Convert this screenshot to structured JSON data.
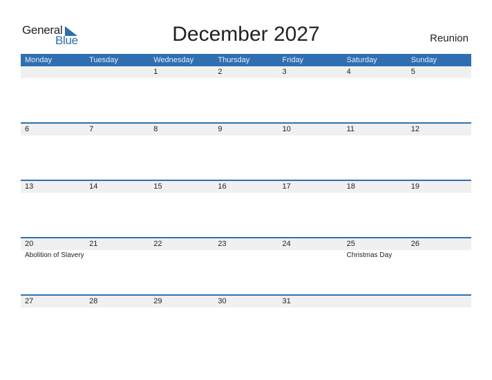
{
  "logo": {
    "word1": "General",
    "word2": "Blue"
  },
  "title": "December 2027",
  "region": "Reunion",
  "colors": {
    "header_bg": "#2e6fb2",
    "accent": "#2a6db5",
    "day_row_bg": "#f0f0f0"
  },
  "weekdays": [
    "Monday",
    "Tuesday",
    "Wednesday",
    "Thursday",
    "Friday",
    "Saturday",
    "Sunday"
  ],
  "weeks": [
    {
      "days": [
        "",
        "",
        "1",
        "2",
        "3",
        "4",
        "5"
      ],
      "holidays": [
        "",
        "",
        "",
        "",
        "",
        "",
        ""
      ]
    },
    {
      "days": [
        "6",
        "7",
        "8",
        "9",
        "10",
        "11",
        "12"
      ],
      "holidays": [
        "",
        "",
        "",
        "",
        "",
        "",
        ""
      ]
    },
    {
      "days": [
        "13",
        "14",
        "15",
        "16",
        "17",
        "18",
        "19"
      ],
      "holidays": [
        "",
        "",
        "",
        "",
        "",
        "",
        ""
      ]
    },
    {
      "days": [
        "20",
        "21",
        "22",
        "23",
        "24",
        "25",
        "26"
      ],
      "holidays": [
        "Abolition of Slavery",
        "",
        "",
        "",
        "",
        "Christmas Day",
        ""
      ]
    },
    {
      "days": [
        "27",
        "28",
        "29",
        "30",
        "31",
        "",
        ""
      ],
      "holidays": [
        "",
        "",
        "",
        "",
        "",
        "",
        ""
      ]
    }
  ]
}
